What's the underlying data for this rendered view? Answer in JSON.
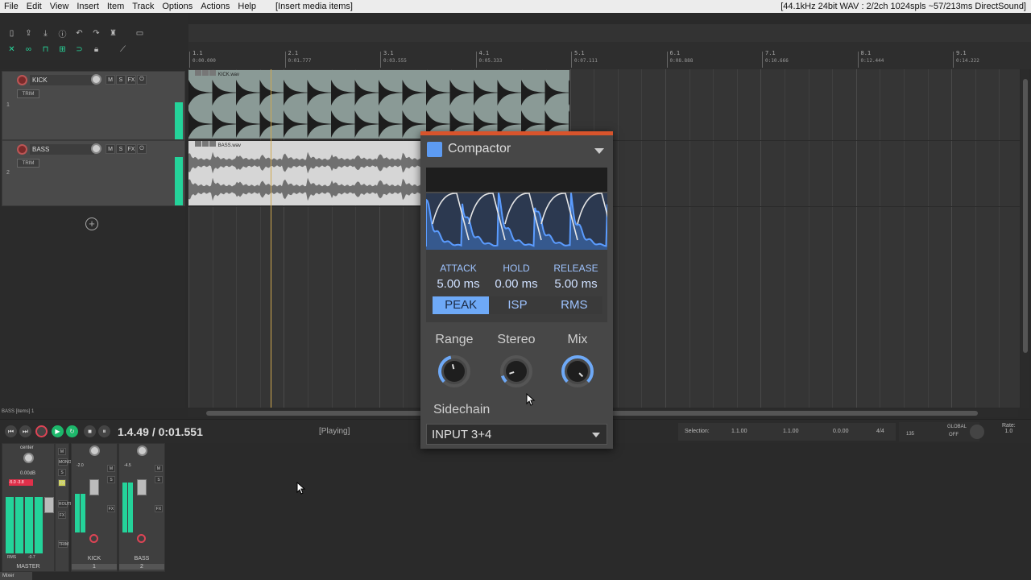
{
  "menubar": {
    "items": [
      "File",
      "Edit",
      "View",
      "Insert",
      "Item",
      "Track",
      "Options",
      "Actions",
      "Help"
    ],
    "hint": "[Insert media items]",
    "status": "[44.1kHz 24bit WAV : 2/2ch 1024spls ~57/213ms DirectSound]"
  },
  "ruler": {
    "ticks": [
      {
        "bar": "1.1",
        "time": "0:00.000"
      },
      {
        "bar": "2.1",
        "time": "0:01.777"
      },
      {
        "bar": "3.1",
        "time": "0:03.555"
      },
      {
        "bar": "4.1",
        "time": "0:05.333"
      },
      {
        "bar": "5.1",
        "time": "0:07.111"
      },
      {
        "bar": "6.1",
        "time": "0:08.888"
      },
      {
        "bar": "7.1",
        "time": "0:10.666"
      },
      {
        "bar": "8.1",
        "time": "0:12.444"
      },
      {
        "bar": "9.1",
        "time": "0:14.222"
      }
    ]
  },
  "tracks": [
    {
      "number": "1",
      "name": "KICK",
      "trim": "TRIM",
      "item_label": "KICK.wav",
      "buttons": [
        "M",
        "S",
        "FX",
        "⏻"
      ]
    },
    {
      "number": "2",
      "name": "BASS",
      "trim": "TRIM",
      "item_label": "BASS.wav",
      "buttons": [
        "M",
        "S",
        "FX",
        "⏻"
      ]
    }
  ],
  "status_left": "BASS [items] 1",
  "transport": {
    "position": "1.4.49 / 0:01.551",
    "state": "[Playing]",
    "selection_label": "Selection:",
    "selection_start": "1.1.00",
    "selection_end": "1.1.00",
    "selection_length": "0.0.00",
    "time_sig": "4/4",
    "bpm": "135",
    "global": "GLOBAL",
    "global_state": "OFF",
    "rate_label": "Rate:",
    "rate_value": "1.0"
  },
  "mixer": {
    "master": {
      "label": "MASTER",
      "pan": "center",
      "vol": "0.00dB",
      "peak_l": "-5.0",
      "peak_r": "-3.8",
      "rms": "RMS",
      "rms_val": "-0.7"
    },
    "side_buttons": [
      "M",
      "MONO",
      "S",
      "FX",
      "ROUTE",
      "FX",
      "TRIM"
    ],
    "strips": [
      {
        "label": "KICK",
        "number": "1",
        "peak": "-2.0"
      },
      {
        "label": "BASS",
        "number": "2",
        "peak": "-4.5"
      }
    ],
    "tab": "Mixer"
  },
  "plugin": {
    "title": "Compactor",
    "accent": "#d8542c",
    "logo_color": "#5d9bf2",
    "params": [
      {
        "label": "ATTACK",
        "value": "5.00 ms"
      },
      {
        "label": "HOLD",
        "value": "0.00 ms"
      },
      {
        "label": "RELEASE",
        "value": "5.00 ms"
      }
    ],
    "modes": [
      "PEAK",
      "ISP",
      "RMS"
    ],
    "active_mode": "PEAK",
    "knobs": [
      {
        "label": "Range",
        "level": 0.45
      },
      {
        "label": "Stereo",
        "level": 0.1
      },
      {
        "label": "Mix",
        "level": 1.0
      }
    ],
    "sidechain_label": "Sidechain",
    "sidechain_value": "INPUT 3+4"
  },
  "toolbar": {
    "row1_icons": [
      "new-project-icon",
      "open-icon",
      "save-icon",
      "info-icon",
      "undo-icon",
      "redo-icon",
      "metronome-icon",
      "grid-icon"
    ],
    "row2_icons": [
      "ripple-icon",
      "link-icon",
      "snap-icon",
      "grid-snap-icon",
      "loop-icon",
      "lock-icon",
      "envelope-icon"
    ]
  }
}
